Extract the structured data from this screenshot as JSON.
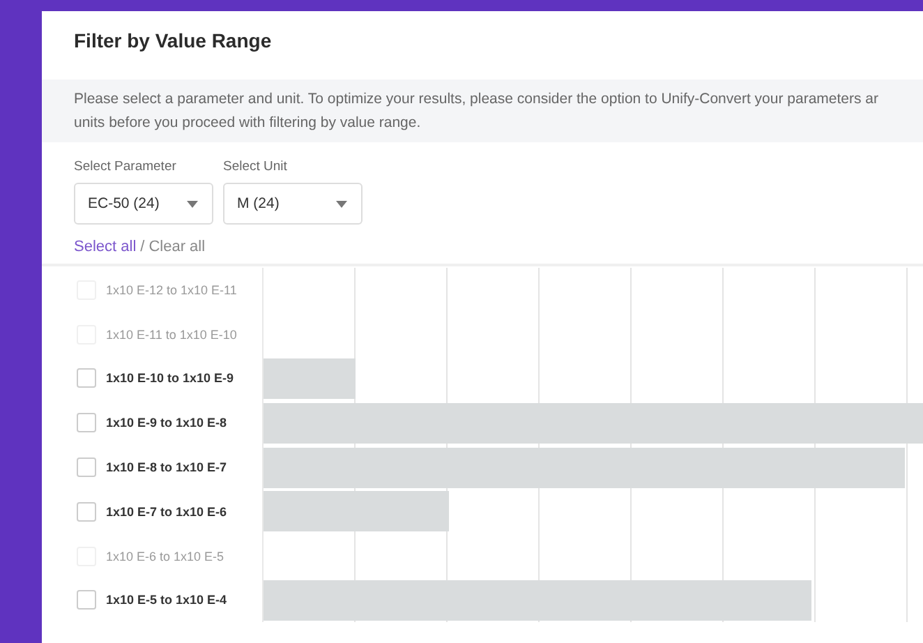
{
  "title": "Filter by Value Range",
  "info": [
    "Please select a parameter and unit. To optimize your results, please consider the option to Unify-Convert your parameters ar",
    "units before you proceed with filtering by value range."
  ],
  "selects": [
    {
      "label": "Select Parameter",
      "value": "EC-50 (24)"
    },
    {
      "label": "Select Unit",
      "value": "M (24)"
    }
  ],
  "select_all": "Select all",
  "separator": "/",
  "clear_all": "Clear all",
  "ranges": [
    {
      "label": "1x10 E-12 to 1x10 E-11",
      "disabled": true,
      "checked": false
    },
    {
      "label": "1x10 E-11 to 1x10 E-10",
      "disabled": true,
      "checked": false
    },
    {
      "label": "1x10 E-10 to 1x10 E-9",
      "disabled": false,
      "checked": false,
      "level": 0.14
    },
    {
      "label": "1x10 E-9 to 1x10 E-8",
      "disabled": false,
      "checked": false,
      "level": 1
    },
    {
      "label": "1x10 E-8 to 1x10 E-7",
      "disabled": false,
      "checked": false,
      "level": 0.97
    },
    {
      "label": "1x10 E-7 to 1x10 E-6",
      "disabled": false,
      "checked": false,
      "level": 0.28
    },
    {
      "label": "1x10 E-6 to 1x10 E-5",
      "disabled": true,
      "checked": false
    },
    {
      "label": "1x10 E-5 to 1x10 E-4",
      "disabled": false,
      "checked": false,
      "level": 0.83
    }
  ]
}
